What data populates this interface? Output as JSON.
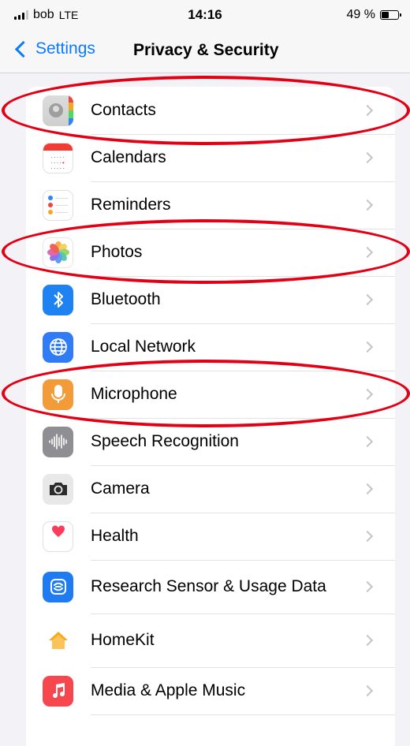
{
  "status_bar": {
    "carrier": "bob",
    "network": "LTE",
    "time": "14:16",
    "battery_text": "49 %",
    "battery_level": 0.49
  },
  "nav": {
    "back_label": "Settings",
    "title": "Privacy & Security"
  },
  "items": [
    {
      "label": "Contacts",
      "icon": "contacts-icon"
    },
    {
      "label": "Calendars",
      "icon": "calendar-icon"
    },
    {
      "label": "Reminders",
      "icon": "reminders-icon"
    },
    {
      "label": "Photos",
      "icon": "photos-icon"
    },
    {
      "label": "Bluetooth",
      "icon": "bluetooth-icon"
    },
    {
      "label": "Local Network",
      "icon": "globe-icon"
    },
    {
      "label": "Microphone",
      "icon": "microphone-icon"
    },
    {
      "label": "Speech Recognition",
      "icon": "waveform-icon"
    },
    {
      "label": "Camera",
      "icon": "camera-icon"
    },
    {
      "label": "Health",
      "icon": "heart-icon"
    },
    {
      "label": "Research Sensor & Usage Data",
      "icon": "research-sensor-icon"
    },
    {
      "label": "HomeKit",
      "icon": "home-icon"
    },
    {
      "label": "Media & Apple Music",
      "icon": "music-note-icon"
    }
  ],
  "colors": {
    "accent": "#0a7aff",
    "annotation": "#e40014"
  }
}
